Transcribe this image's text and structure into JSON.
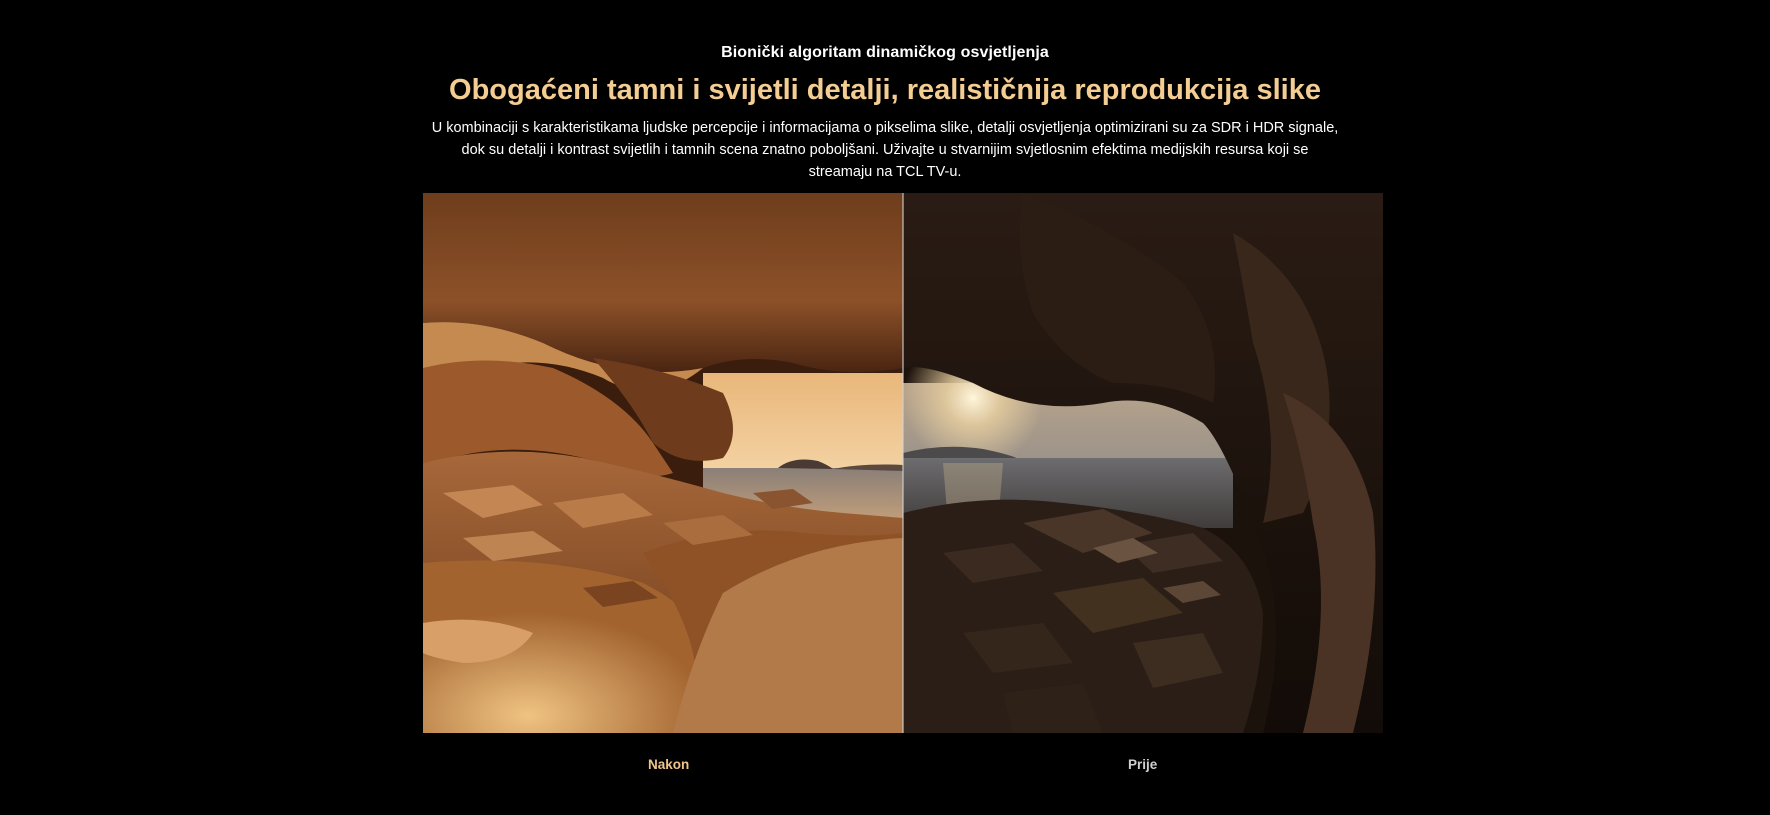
{
  "section": {
    "eyebrow": "Bionički algoritam dinamičkog osvjetljenja",
    "headline": "Obogaćeni tamni i svijetli detalji, realističnija reprodukcija slike",
    "description": "U kombinaciji s karakteristikama ljudske percepcije i informacijama o pikselima slike, detalji osvjetljenja optimizirani su za SDR i HDR signale, dok su detalji i kontrast svijetlih i tamnih scena znatno poboljšani. Uživajte u stvarnijim svjetlosnim efektima medijskih resursa koji se streamaju na TCL TV-u."
  },
  "comparison": {
    "after_label": "Nakon",
    "before_label": "Prije",
    "slider_position": 0.5
  },
  "colors": {
    "background": "#000000",
    "headline": "#f3cd92",
    "after_label": "#f1c58a",
    "before_label": "#cfcfcf"
  }
}
